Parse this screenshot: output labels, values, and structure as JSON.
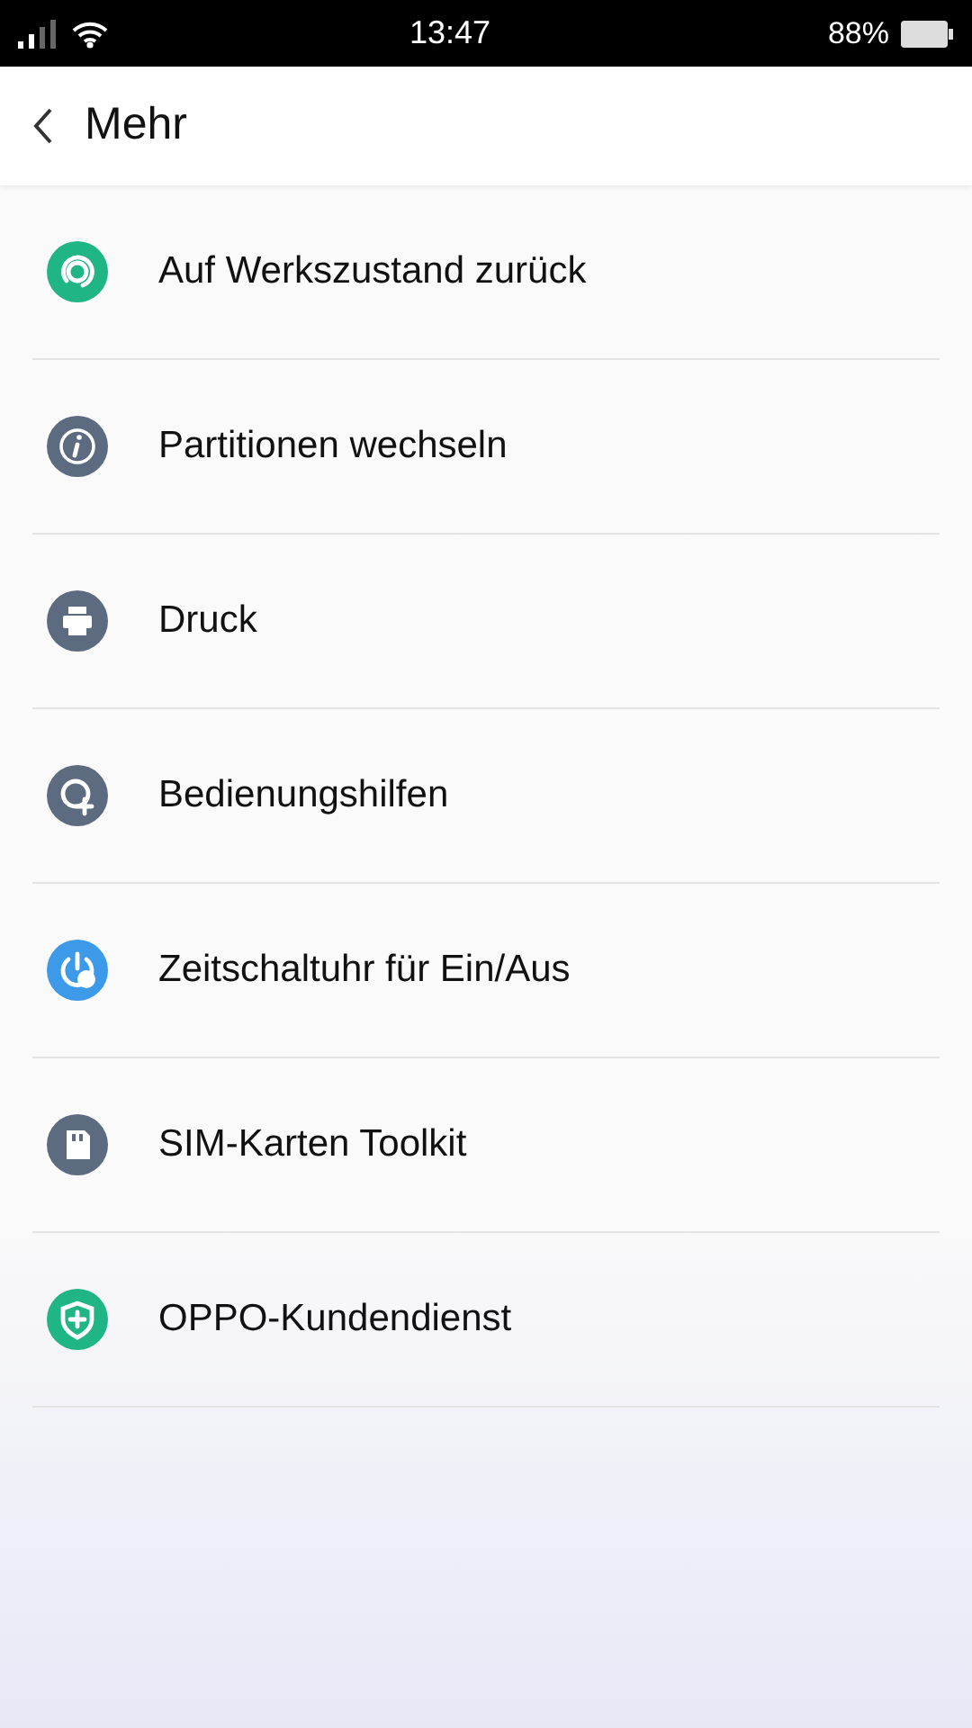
{
  "status_bar": {
    "time": "13:47",
    "battery": "88%"
  },
  "header": {
    "title": "Mehr"
  },
  "items": [
    {
      "label": "Auf Werkszustand zurück",
      "color": "#1fb585"
    },
    {
      "label": "Partitionen wechseln",
      "color": "#5d6b80"
    },
    {
      "label": "Druck",
      "color": "#5d6b80"
    },
    {
      "label": "Bedienungshilfen",
      "color": "#5d6b80"
    },
    {
      "label": "Zeitschaltuhr für Ein/Aus",
      "color": "#3d9ae8"
    },
    {
      "label": "SIM-Karten Toolkit",
      "color": "#5d6b80"
    },
    {
      "label": "OPPO-Kundendienst",
      "color": "#1fb585"
    }
  ]
}
